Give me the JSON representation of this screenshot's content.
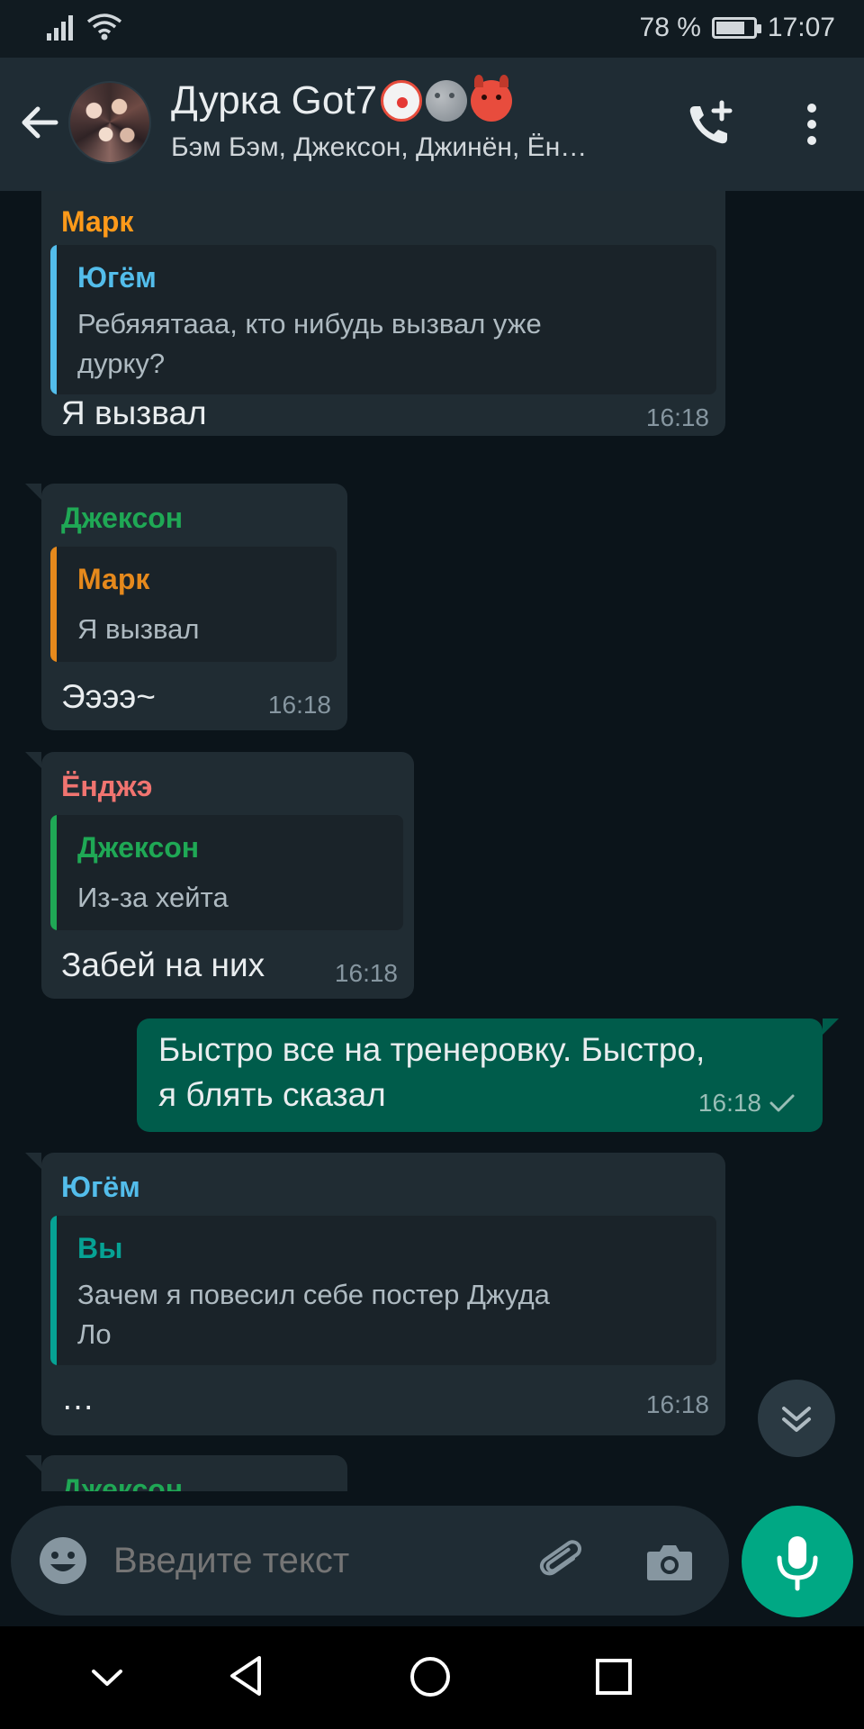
{
  "status_bar": {
    "battery": "78 %",
    "battery_level": 0.78,
    "time": "17:07"
  },
  "header": {
    "title": "Дурка Got7",
    "title_emojis": [
      "clown-face",
      "new-moon-face",
      "smiling-devil"
    ],
    "subtitle": "Бэм Бэм, Джексон, Джинён, Ён…"
  },
  "messages": [
    {
      "sender": "Марк",
      "sender_color": "#ff9a1a",
      "quote_name": "Югём",
      "quote_color": "#53bdeb",
      "quote_line1": "Ребяяятааа,  кто нибудь вызвал уже",
      "quote_line2": "дурку?",
      "text": "Я вызвал",
      "time": "16:18"
    },
    {
      "sender": "Джексон",
      "sender_color": "#1fa855",
      "quote_name": "Марк",
      "quote_color": "#e6891c",
      "quote_line1": "Я вызвал",
      "text": "Ээээ~",
      "time": "16:18"
    },
    {
      "sender": "Ёнджэ",
      "sender_color": "#f07470",
      "quote_name": "Джексон",
      "quote_color": "#1fa855",
      "quote_line1": "Из-за хейта",
      "text": "Забей на них",
      "time": "16:18"
    },
    {
      "outgoing": true,
      "line1": "Быстро все на тренеровку. Быстро,",
      "line2": "я блять сказал",
      "time": "16:18",
      "status": "sent"
    },
    {
      "sender": "Югём",
      "sender_color": "#53bdeb",
      "quote_name": "Вы",
      "quote_color": "#06a294",
      "quote_line1": "Зачем я повесил себе постер Джуда",
      "quote_line2": "Ло",
      "text": "…",
      "time": "16:18"
    },
    {
      "sender": "Джексон",
      "sender_color": "#1fa855",
      "partial": true
    }
  ],
  "input": {
    "placeholder": "Введите текст"
  },
  "colors": {
    "accent": "#00a884",
    "outgoing_bubble": "#005c4b",
    "incoming_bubble": "#202c33"
  }
}
